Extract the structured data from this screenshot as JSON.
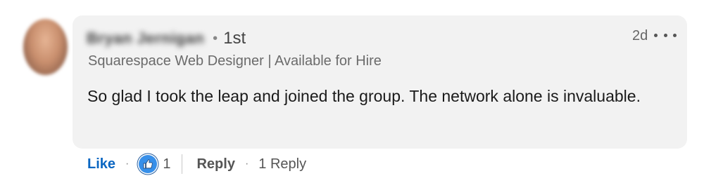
{
  "comment": {
    "author_name": "Bryan Jernigan",
    "connection_degree": "1st",
    "headline": "Squarespace Web Designer | Available for Hire",
    "timestamp": "2d",
    "text": "So glad I took the leap and joined the group. The network alone is invaluable."
  },
  "actions": {
    "like_label": "Like",
    "reaction_icon": "thumbs-up-icon",
    "reaction_count": "1",
    "reply_label": "Reply",
    "reply_count": "1 Reply"
  },
  "colors": {
    "bubble_bg": "#f2f2f2",
    "like_blue": "#0a66c2",
    "reaction_blue": "#378fe9"
  }
}
